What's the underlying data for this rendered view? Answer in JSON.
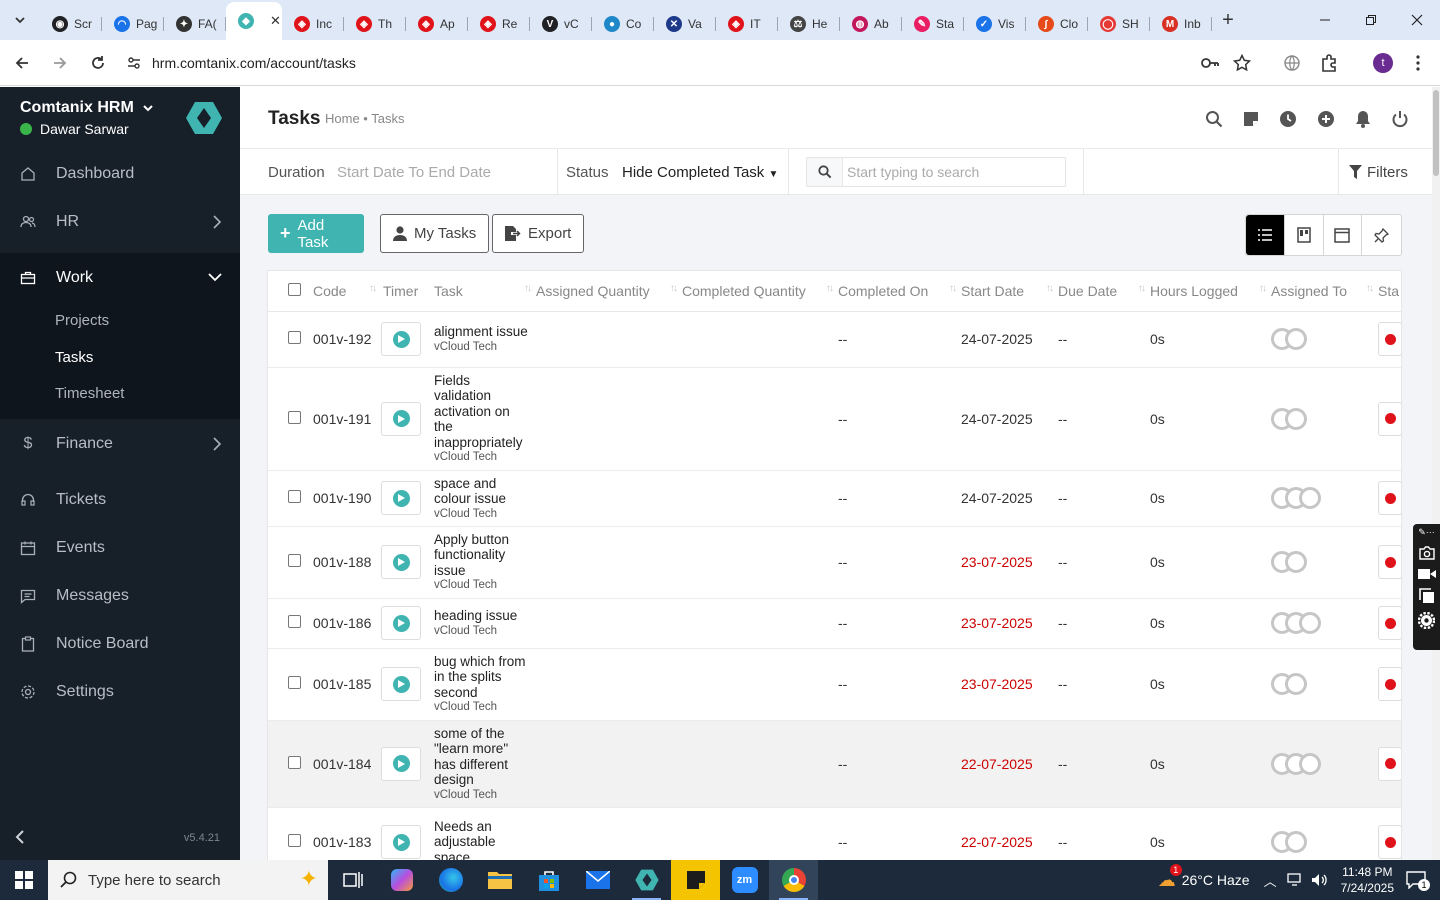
{
  "browser": {
    "tabs": [
      {
        "title": "Scr",
        "color": "#202124",
        "glyph": "◉"
      },
      {
        "title": "Pag",
        "color": "#1a73e8",
        "glyph": "◠"
      },
      {
        "title": "FA(",
        "color": "#333333",
        "glyph": "✦"
      },
      {
        "title": "",
        "color": "#3fb4b1",
        "glyph": "◆",
        "active": true
      },
      {
        "title": "Inc",
        "color": "#e0131a",
        "glyph": "◈"
      },
      {
        "title": "Th",
        "color": "#e0131a",
        "glyph": "◈"
      },
      {
        "title": "Ap",
        "color": "#e0131a",
        "glyph": "◈"
      },
      {
        "title": "Re",
        "color": "#e0131a",
        "glyph": "◈"
      },
      {
        "title": "vC",
        "color": "#202124",
        "glyph": "V"
      },
      {
        "title": "Co",
        "color": "#1e88c8",
        "glyph": "●"
      },
      {
        "title": "Va",
        "color": "#1d3a8a",
        "glyph": "✕"
      },
      {
        "title": "IT",
        "color": "#e0131a",
        "glyph": "◈"
      },
      {
        "title": "He",
        "color": "#444444",
        "glyph": "⚖"
      },
      {
        "title": "Ab",
        "color": "#c2185b",
        "glyph": "◍"
      },
      {
        "title": "Sta",
        "color": "#e91e63",
        "glyph": "✎"
      },
      {
        "title": "Vis",
        "color": "#1a73e8",
        "glyph": "✓"
      },
      {
        "title": "Clo",
        "color": "#e64a19",
        "glyph": "∫"
      },
      {
        "title": "SH",
        "color": "#e53935",
        "glyph": "◯"
      },
      {
        "title": "Inb",
        "color": "#d93025",
        "glyph": "M"
      }
    ],
    "url": "hrm.comtanix.com/account/tasks"
  },
  "sidebar": {
    "brand": "Comtanix HRM",
    "user": "Dawar Sarwar",
    "items": [
      {
        "label": "Dashboard",
        "icon": "home-icon"
      },
      {
        "label": "HR",
        "icon": "users-icon"
      },
      {
        "label": "Work",
        "icon": "briefcase-icon"
      },
      {
        "label": "Finance",
        "icon": "dollar-icon"
      },
      {
        "label": "Tickets",
        "icon": "headset-icon"
      },
      {
        "label": "Events",
        "icon": "calendar-icon"
      },
      {
        "label": "Messages",
        "icon": "message-icon"
      },
      {
        "label": "Notice Board",
        "icon": "clipboard-icon"
      },
      {
        "label": "Settings",
        "icon": "gear-icon"
      }
    ],
    "work_sub": [
      "Projects",
      "Tasks",
      "Timesheet"
    ],
    "version": "v5.4.21"
  },
  "header": {
    "title": "Tasks",
    "breadcrumb": "Home • Tasks"
  },
  "filters": {
    "duration_label": "Duration",
    "duration_value": "Start Date To End Date",
    "status_label": "Status",
    "status_value": "Hide Completed Task",
    "search_placeholder": "Start typing to search",
    "filters_label": "Filters"
  },
  "actions": {
    "add_task": "Add Task",
    "my_tasks": "My Tasks",
    "export": "Export"
  },
  "table": {
    "columns": [
      "Code",
      "Timer",
      "Task",
      "Assigned Quantity",
      "Completed Quantity",
      "Completed On",
      "Start Date",
      "Due Date",
      "Hours Logged",
      "Assigned To",
      "Sta"
    ],
    "rows": [
      {
        "code": "001v-192",
        "task": "alignment issue",
        "project": "vCloud Tech",
        "completed_on": "--",
        "start": "24-07-2025",
        "start_overdue": false,
        "due": "--",
        "hours": "0s",
        "assignees": 2,
        "highlight": false
      },
      {
        "code": "001v-191",
        "task": "Fields validation activation on the inappropriately",
        "project": "vCloud Tech",
        "completed_on": "--",
        "start": "24-07-2025",
        "start_overdue": false,
        "due": "--",
        "hours": "0s",
        "assignees": 2,
        "highlight": false
      },
      {
        "code": "001v-190",
        "task": "space and colour issue",
        "project": "vCloud Tech",
        "completed_on": "--",
        "start": "24-07-2025",
        "start_overdue": false,
        "due": "--",
        "hours": "0s",
        "assignees": 3,
        "highlight": false
      },
      {
        "code": "001v-188",
        "task": "Apply button functionality issue",
        "project": "vCloud Tech",
        "completed_on": "--",
        "start": "23-07-2025",
        "start_overdue": true,
        "due": "--",
        "hours": "0s",
        "assignees": 2,
        "highlight": false
      },
      {
        "code": "001v-186",
        "task": "heading issue",
        "project": "vCloud Tech",
        "completed_on": "--",
        "start": "23-07-2025",
        "start_overdue": true,
        "due": "--",
        "hours": "0s",
        "assignees": 3,
        "highlight": false
      },
      {
        "code": "001v-185",
        "task": "bug which from in the splits second",
        "project": "vCloud Tech",
        "completed_on": "--",
        "start": "23-07-2025",
        "start_overdue": true,
        "due": "--",
        "hours": "0s",
        "assignees": 2,
        "highlight": false
      },
      {
        "code": "001v-184",
        "task": "some of the \"learn more\" has different design",
        "project": "vCloud Tech",
        "completed_on": "--",
        "start": "22-07-2025",
        "start_overdue": true,
        "due": "--",
        "hours": "0s",
        "assignees": 3,
        "highlight": true
      },
      {
        "code": "001v-183",
        "task": "Needs an adjustable space",
        "project": "",
        "completed_on": "--",
        "start": "22-07-2025",
        "start_overdue": true,
        "due": "--",
        "hours": "0s",
        "assignees": 2,
        "highlight": false
      }
    ]
  },
  "taskbar": {
    "search_placeholder": "Type here to search",
    "weather": "26°C  Haze",
    "weather_badge": "1",
    "time": "11:48 PM",
    "date": "7/24/2025",
    "notification_count": "1"
  },
  "colors": {
    "sidebar_bg": "#171f29",
    "accent": "#3fb4b1",
    "overdue": "#cc0000",
    "status_dot": "#e0131a"
  }
}
